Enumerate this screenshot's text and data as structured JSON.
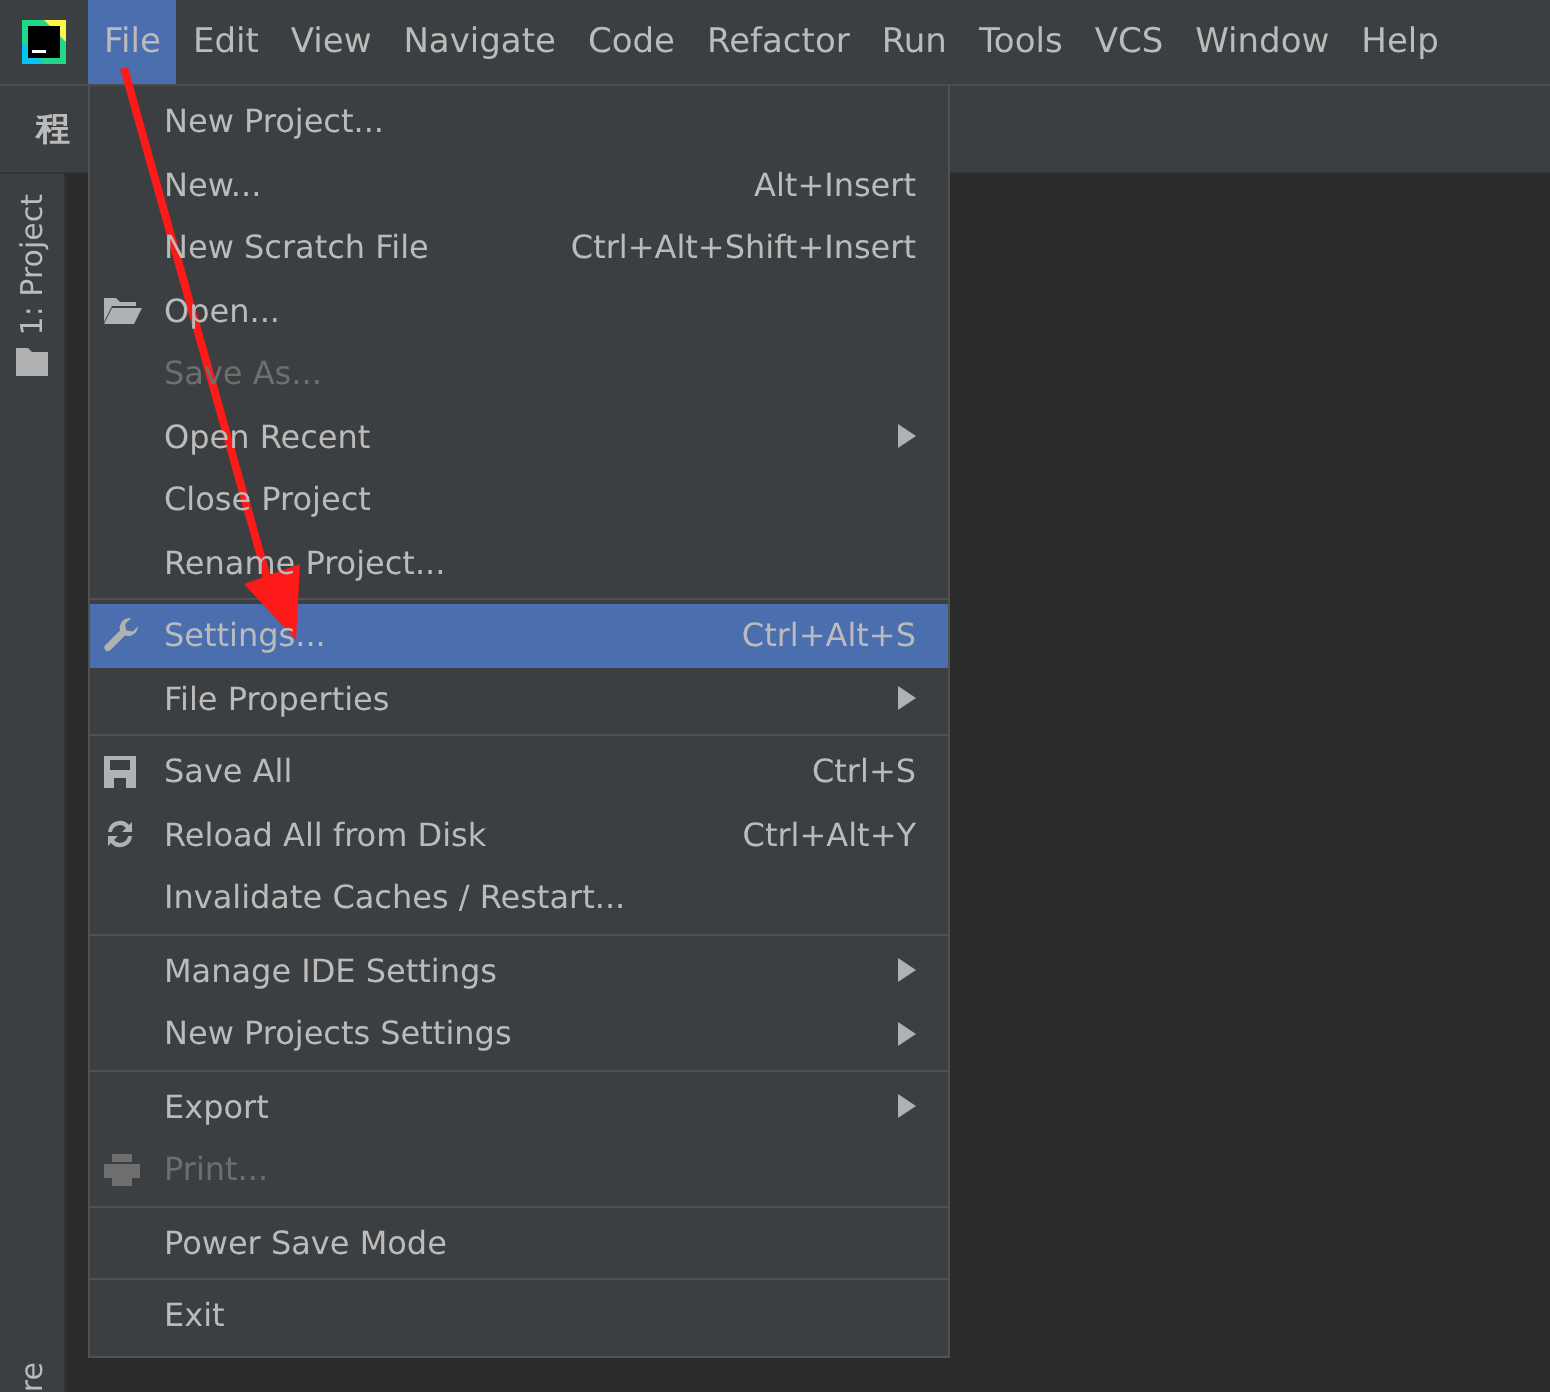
{
  "menubar": [
    {
      "label": "File",
      "selected": true
    },
    {
      "label": "Edit",
      "selected": false
    },
    {
      "label": "View",
      "selected": false
    },
    {
      "label": "Navigate",
      "selected": false
    },
    {
      "label": "Code",
      "selected": false
    },
    {
      "label": "Refactor",
      "selected": false
    },
    {
      "label": "Run",
      "selected": false
    },
    {
      "label": "Tools",
      "selected": false
    },
    {
      "label": "VCS",
      "selected": false
    },
    {
      "label": "Window",
      "selected": false
    },
    {
      "label": "Help",
      "selected": false
    }
  ],
  "toolbar": {
    "title": "程"
  },
  "tool_windows": {
    "top": "1: Project",
    "bottom": "re"
  },
  "menu": {
    "groups": [
      [
        {
          "label": "New Project...",
          "kind": "plain",
          "submenu": false,
          "disabled": false,
          "selected": false
        },
        {
          "label": "New...",
          "shortcut": "Alt+Insert",
          "kind": "plain",
          "submenu": false,
          "disabled": false,
          "selected": false
        },
        {
          "label": "New Scratch File",
          "shortcut": "Ctrl+Alt+Shift+Insert",
          "kind": "plain",
          "submenu": false,
          "disabled": false,
          "selected": false
        },
        {
          "label": "Open...",
          "kind": "folder",
          "submenu": false,
          "disabled": false,
          "selected": false
        },
        {
          "label": "Save As...",
          "kind": "plain",
          "submenu": false,
          "disabled": true,
          "selected": false
        },
        {
          "label": "Open Recent",
          "kind": "plain",
          "submenu": true,
          "disabled": false,
          "selected": false
        },
        {
          "label": "Close Project",
          "kind": "plain",
          "submenu": false,
          "disabled": false,
          "selected": false
        },
        {
          "label": "Rename Project...",
          "kind": "plain",
          "submenu": false,
          "disabled": false,
          "selected": false
        }
      ],
      [
        {
          "label": "Settings...",
          "shortcut": "Ctrl+Alt+S",
          "kind": "wrench",
          "submenu": false,
          "disabled": false,
          "selected": true
        },
        {
          "label": "File Properties",
          "kind": "plain",
          "submenu": true,
          "disabled": false,
          "selected": false
        }
      ],
      [
        {
          "label": "Save All",
          "shortcut": "Ctrl+S",
          "kind": "save",
          "submenu": false,
          "disabled": false,
          "selected": false
        },
        {
          "label": "Reload All from Disk",
          "shortcut": "Ctrl+Alt+Y",
          "kind": "reload",
          "submenu": false,
          "disabled": false,
          "selected": false
        },
        {
          "label": "Invalidate Caches / Restart...",
          "kind": "plain",
          "submenu": false,
          "disabled": false,
          "selected": false
        }
      ],
      [
        {
          "label": "Manage IDE Settings",
          "kind": "plain",
          "submenu": true,
          "disabled": false,
          "selected": false
        },
        {
          "label": "New Projects Settings",
          "kind": "plain",
          "submenu": true,
          "disabled": false,
          "selected": false
        }
      ],
      [
        {
          "label": "Export",
          "kind": "plain",
          "submenu": true,
          "disabled": false,
          "selected": false
        },
        {
          "label": "Print...",
          "kind": "printer",
          "submenu": false,
          "disabled": true,
          "selected": false
        }
      ],
      [
        {
          "label": "Power Save Mode",
          "kind": "plain",
          "submenu": false,
          "disabled": false,
          "selected": false
        }
      ],
      [
        {
          "label": "Exit",
          "kind": "plain",
          "submenu": false,
          "disabled": false,
          "selected": false
        }
      ]
    ]
  }
}
